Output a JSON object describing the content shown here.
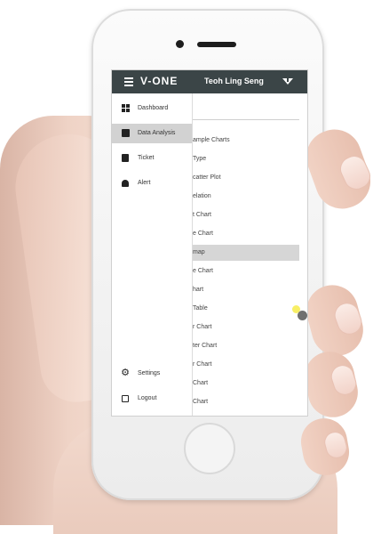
{
  "app": {
    "brand": "V-ONE",
    "user_name": "Teoh Ling Seng"
  },
  "icons": {
    "menu": "hamburger-icon",
    "filter": "filter-icon"
  },
  "sidebar": {
    "items": [
      {
        "label": "Dashboard",
        "icon": "dashboard-icon",
        "active": false
      },
      {
        "label": "Data Analysis",
        "icon": "data-analysis-icon",
        "active": true
      },
      {
        "label": "Ticket",
        "icon": "ticket-icon",
        "active": false
      },
      {
        "label": "Alert",
        "icon": "bell-icon",
        "active": false
      }
    ],
    "bottom_items": [
      {
        "label": "Settings",
        "icon": "gear-icon"
      },
      {
        "label": "Logout",
        "icon": "logout-icon"
      }
    ]
  },
  "content": {
    "items": [
      "ample Charts",
      "Type",
      "catter Plot",
      "elation",
      "t Chart",
      "e Chart",
      "map",
      "e Chart",
      "hart",
      "Table",
      "r Chart",
      "ter Chart",
      "r Chart",
      "Chart",
      "Chart"
    ],
    "highlighted_index": 6
  },
  "colors": {
    "topbar": "#3b4547",
    "active_nav": "#d2d2d2",
    "highlight": "#d6d6d6"
  }
}
